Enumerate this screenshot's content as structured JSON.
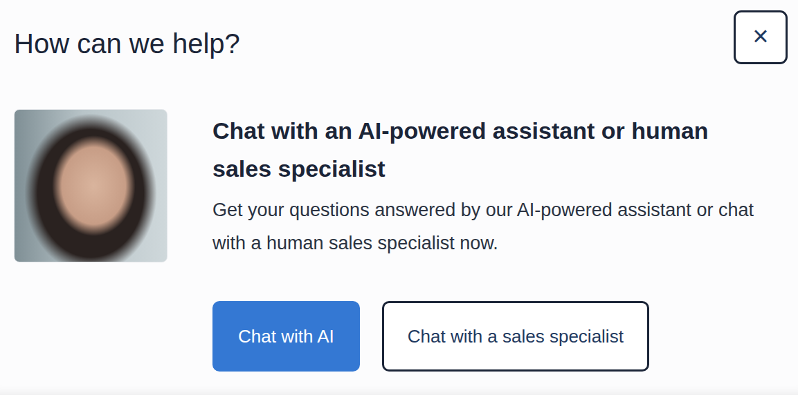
{
  "title": "How can we help?",
  "close_button": {
    "label": "×"
  },
  "card": {
    "heading": "Chat with an AI-powered assistant or human sales specialist",
    "description": "Get your questions answered by our AI-powered assistant or chat with a human sales specialist now.",
    "buttons": [
      {
        "label": "Chat with AI",
        "kind": "primary"
      },
      {
        "label": "Chat with a sales specialist",
        "kind": "outline"
      }
    ]
  }
}
